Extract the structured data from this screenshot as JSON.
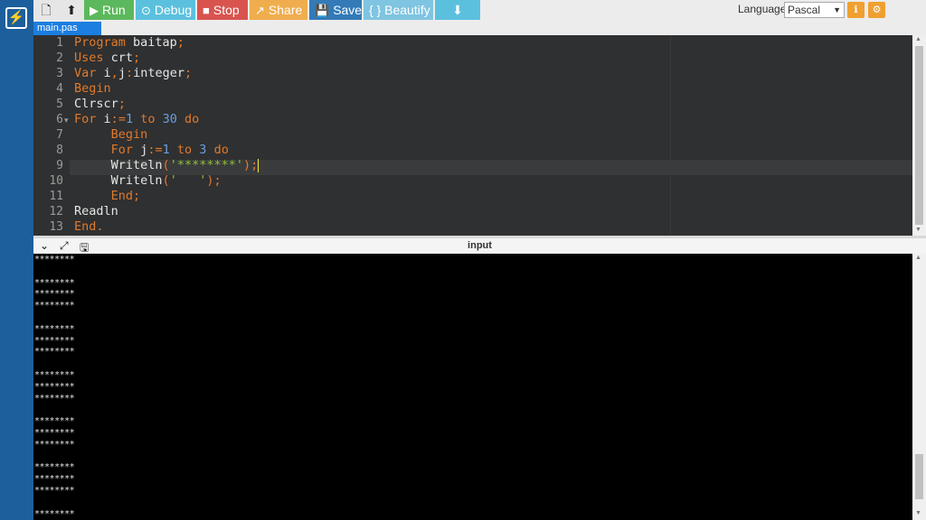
{
  "toolbar": {
    "new_icon": "file-icon",
    "upload_icon": "upload-icon",
    "run_label": "Run",
    "debug_label": "Debug",
    "stop_label": "Stop",
    "share_label": "Share",
    "save_label": "Save",
    "beautify_label": "{ } Beautify",
    "download_icon": "download-icon",
    "language_label": "Language",
    "language_value": "Pascal",
    "colors": {
      "run": "#5cb85c",
      "debug": "#5bc0de",
      "stop": "#d9534f",
      "share": "#f0ad4e",
      "save": "#337ab7",
      "beautify": "#7fc4e0",
      "download": "#5bc0de"
    }
  },
  "tabs": [
    {
      "label": "main.pas"
    }
  ],
  "editor": {
    "line_numbers": [
      "1",
      "2",
      "3",
      "4",
      "5",
      "6",
      "7",
      "8",
      "9",
      "10",
      "11",
      "12",
      "13"
    ],
    "lines": [
      "Program baitap;",
      "Uses crt;",
      "Var i,j:integer;",
      "Begin",
      "Clrscr;",
      "For i:=1 to 30 do",
      "     Begin",
      "     For j:=1 to 3 do",
      "     Writeln('********');",
      "     Writeln('   ');",
      "     End;",
      "Readln",
      "End."
    ]
  },
  "output": {
    "title": "input",
    "rows": [
      "********",
      "",
      "********",
      "********",
      "********",
      "",
      "********",
      "********",
      "********",
      "",
      "********",
      "********",
      "********",
      "",
      "********",
      "********",
      "********",
      "",
      "********",
      "********",
      "********",
      "",
      "********"
    ]
  }
}
